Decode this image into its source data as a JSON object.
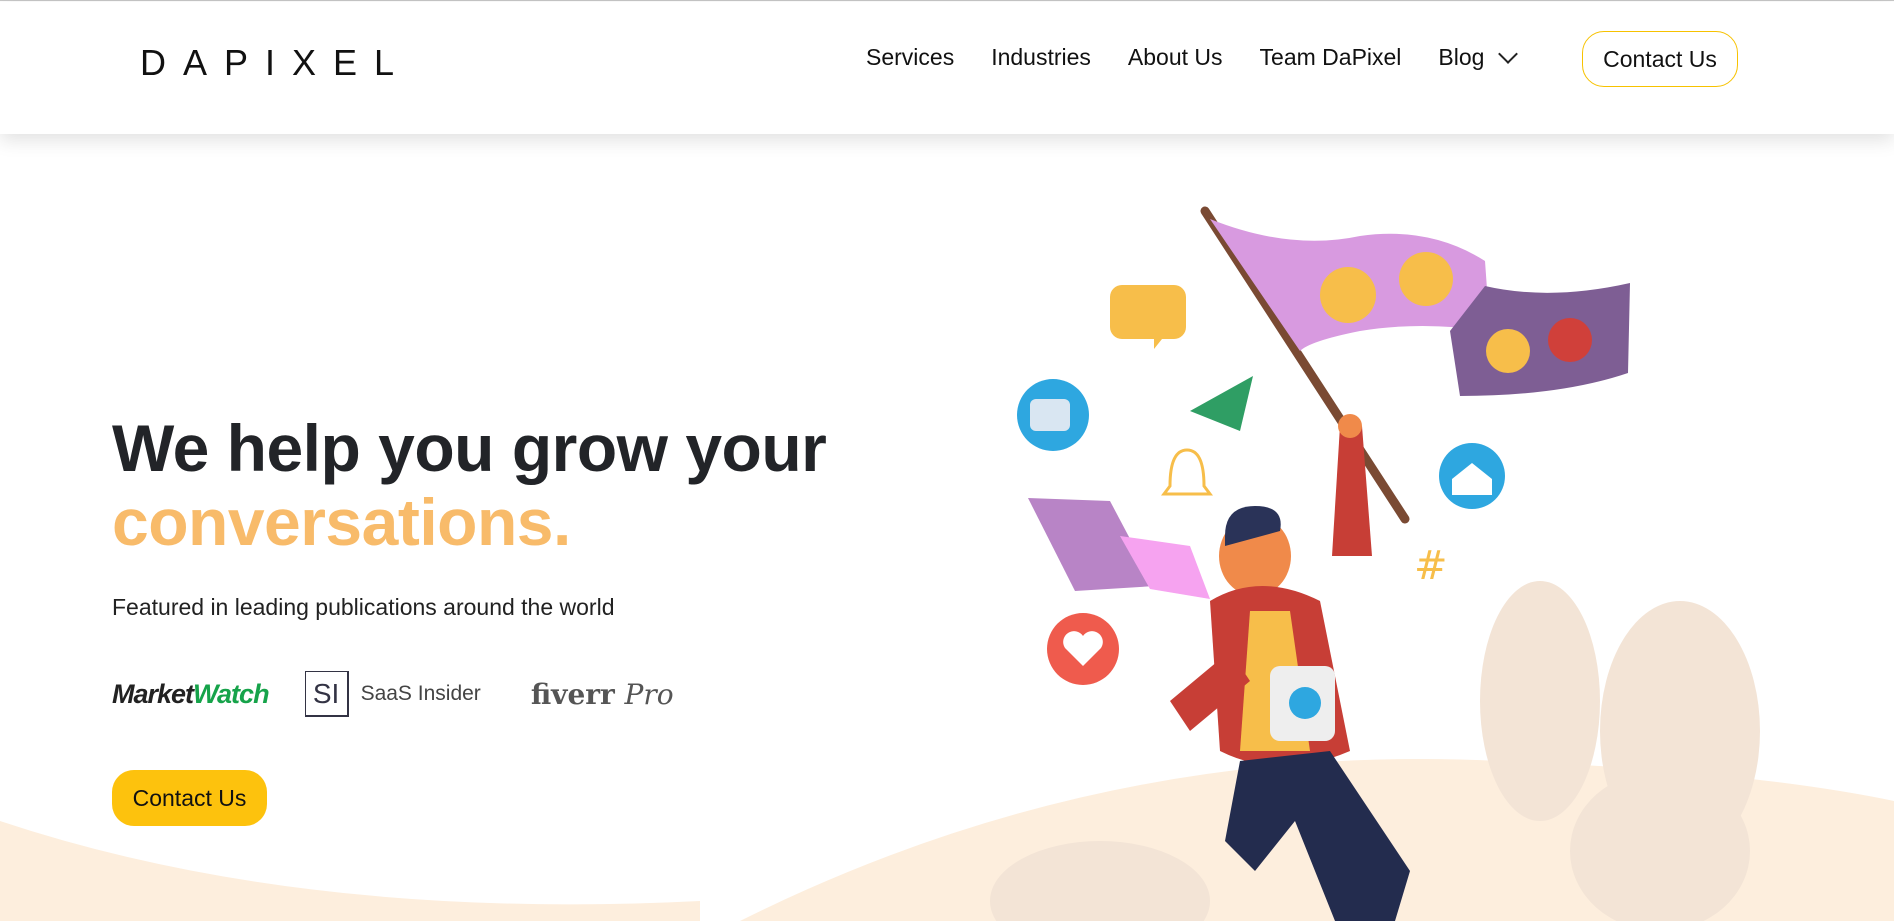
{
  "header": {
    "logo": "DAPIXEL",
    "nav": [
      {
        "label": "Services"
      },
      {
        "label": "Industries"
      },
      {
        "label": "About Us"
      },
      {
        "label": "Team DaPixel"
      },
      {
        "label": "Blog"
      }
    ],
    "contact_label": "Contact Us"
  },
  "hero": {
    "title_line1": "We help you grow your",
    "title_line2": "conversations.",
    "featured": "Featured in leading publications around the world",
    "publications": {
      "marketwatch_a": "Market",
      "marketwatch_b": "Watch",
      "saas_mark": "SI",
      "saas_name": "SaaS Insider",
      "fiverr": "fiverr",
      "fiverr_pro": "Pro"
    },
    "cta_label": "Contact Us"
  },
  "colors": {
    "accent": "#f8bb6a",
    "button": "#fdc20d",
    "nav_border": "#f7c200",
    "background_wave": "#fdeedd"
  }
}
